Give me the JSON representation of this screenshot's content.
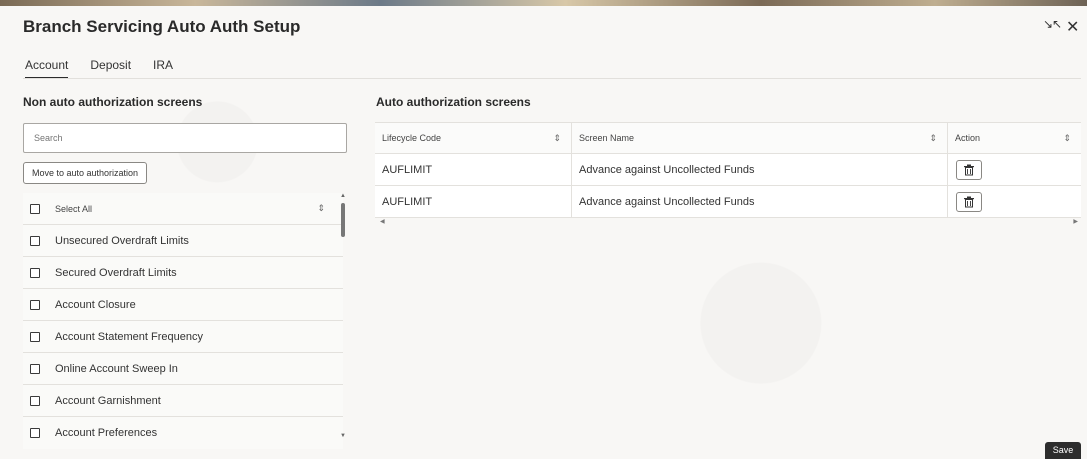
{
  "window": {
    "title": "Branch Servicing Auto Auth Setup",
    "collapse_icon": "↘↖",
    "close_icon": "✕"
  },
  "tabs": [
    {
      "label": "Account",
      "active": true
    },
    {
      "label": "Deposit",
      "active": false
    },
    {
      "label": "IRA",
      "active": false
    }
  ],
  "left_panel": {
    "heading": "Non auto authorization screens",
    "search_placeholder": "Search",
    "move_button": "Move to auto authorization",
    "select_all": "Select All",
    "items": [
      "Unsecured Overdraft Limits",
      "Secured Overdraft Limits",
      "Account Closure",
      "Account Statement Frequency",
      "Online Account Sweep In",
      "Account Garnishment",
      "Account Preferences"
    ]
  },
  "right_panel": {
    "heading": "Auto authorization screens",
    "columns": [
      "Lifecycle Code",
      "Screen Name",
      "Action"
    ],
    "rows": [
      {
        "code": "AUFLIMIT",
        "screen": "Advance against Uncollected Funds",
        "action_icon": "delete-icon"
      },
      {
        "code": "AUFLIMIT",
        "screen": "Advance against Uncollected Funds",
        "action_icon": "delete-icon"
      }
    ]
  },
  "footer": {
    "save_label": "Save"
  },
  "colors": {
    "accent_dark": "#2d2d2d",
    "border": "#a9a7a3",
    "background": "#f8f7f5"
  }
}
